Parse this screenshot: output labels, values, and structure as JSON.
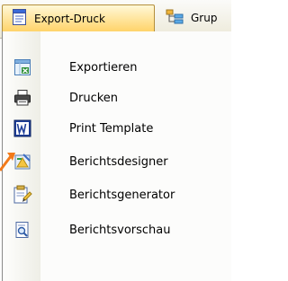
{
  "toolbar": {
    "export_label": "Export-Druck",
    "group_label": "Grup"
  },
  "menu": {
    "items": [
      {
        "label": "Exportieren",
        "icon": "excel-export-icon"
      },
      {
        "label": "Drucken",
        "icon": "printer-icon"
      },
      {
        "label": "Print Template",
        "icon": "word-template-icon"
      },
      {
        "label": "Berichtsdesigner",
        "icon": "report-designer-icon"
      },
      {
        "label": "Berichtsgenerator",
        "icon": "report-generator-icon"
      },
      {
        "label": "Berichtsvorschau",
        "icon": "report-preview-icon"
      }
    ]
  },
  "colors": {
    "active_button_top": "#fff8d8",
    "active_button_bottom": "#ffd36a",
    "arrow": "#f27a1a"
  }
}
